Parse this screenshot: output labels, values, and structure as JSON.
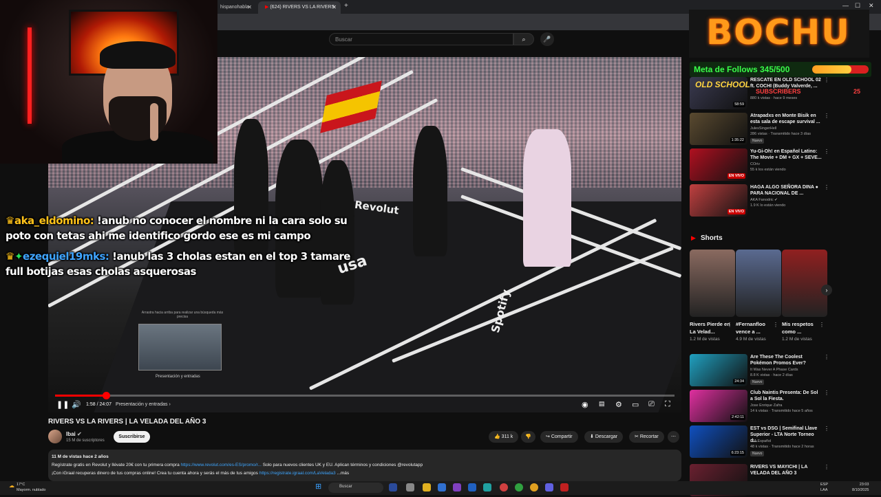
{
  "browser": {
    "tabs": [
      {
        "label": "hispanohabla",
        "active": false
      },
      {
        "label": "(624) RIVERS VS LA RIVERS",
        "active": true
      }
    ],
    "new_tab": "+"
  },
  "youtube": {
    "search_placeholder": "Buscar"
  },
  "stream_overlay": {
    "chat": [
      {
        "user": "aka_eldomino:",
        "message": "!anub no conocer el nombre ni la cara solo su",
        "message2": "poto con tetas ahi me identifico gordo ese es mi campo"
      },
      {
        "user": "ezequiel19mks:",
        "message": "!anub las 3 cholas estan en el top 3 tamare",
        "message2": "full botijas esas cholas asquerosas"
      }
    ],
    "brand": "BOCHU",
    "follow_goal": {
      "label": "Meta de Follows 345/500",
      "current": 345,
      "target": 500
    },
    "old_school": "OLD SCHOOL",
    "subscribers_label": "SUBSCRIBERS",
    "subscribers_count": "25"
  },
  "player": {
    "timecode": "1:58 / 24:07",
    "chapter": "Presentación y entradas",
    "progress": 0.082,
    "preview_hint": "Arrastra hacia arriba para realizar una búsqueda más precisa",
    "preview_label": "Presentación y entradas",
    "canvas_brand1": "Revolut",
    "canvas_brand2": "usa",
    "canvas_brand3": "Spotify"
  },
  "video": {
    "title": "RIVERS VS LA RIVERS | LA VELADA DEL AÑO 3",
    "channel": "Ibai",
    "subscribers": "15 M de suscriptores",
    "subscribe_label": "Suscribirse",
    "likes": "311 k",
    "share_label": "Compartir",
    "download_label": "Descargar",
    "clip_label": "Recortar",
    "description": {
      "line1": "11 M de vistas  hace 2 años",
      "line2a": "Regístrate gratis en Revolut y llévate 20€ con tu primera compra",
      "line2_link": "https://www.revolut.com/es-ES/promo/r...",
      "line2b": "Solo para nuevos clientes UK y EU. Aplican términos y condiciones @revolutapp",
      "line3a": "¡Con iGraal recuperas dinero de tus compras online! Crea tu cuenta ahora y serás el más",
      "line3b": "de tus amigos",
      "line3_link": "https://registrate.igraal.com/LaVelada3",
      "line3_more": "...más"
    }
  },
  "recommendations": [
    {
      "title": "RESCATE EN OLD SCHOOL 02 ft. COCHI (Buddy Valverde, ...",
      "channel": "",
      "meta": "880 k vistas · hace 9 meses",
      "duration": "58:59",
      "live": false,
      "new": false,
      "color": "#3a3a50"
    },
    {
      "title": "Atrapadxs en Monte Bisik en esta sala de escape survival ...",
      "channel": "JulesSingerHell",
      "meta": "286 vistas · Transmitido hace 3 días",
      "duration": "1:35:22",
      "live": false,
      "new": true,
      "color": "#5a4a30"
    },
    {
      "title": "Yu-Gi-Oh! en Español Latino: The Movie + DM + GX + SEVE...",
      "channel": "COriv",
      "meta": "55 k los están viendo",
      "duration": "EN VIVO",
      "live": true,
      "new": false,
      "color": "#b01020"
    },
    {
      "title": "HAGA ALGO SEÑORA DINA ● PARA NACIONAL DE ...",
      "channel": "AKA Fanodric ✔",
      "meta": "1.9 K lo están viendo",
      "duration": "EN VIVO",
      "live": true,
      "new": false,
      "color": "#c04040"
    },
    {
      "title": "Are These The Coolest Pokémon Promos Ever?",
      "channel": "It Was Never A Phase Cards",
      "meta": "8.8 K vistas · hace 2 días",
      "duration": "24:34",
      "live": false,
      "new": true,
      "color": "#20a0c0"
    },
    {
      "title": "Club Naintis Presenta: De Sol a Sol la Fiesta.",
      "channel": "Jose Enrique Zafra",
      "meta": "14 k vistas · Transmitido hace 5 años",
      "duration": "2:42:11",
      "live": false,
      "new": false,
      "color": "#e030a0"
    },
    {
      "title": "EST vs DSG | Semifinal Llave Superior - LTA Norte Torneo d...",
      "channel": "LTA Español",
      "meta": "48 k vistas · Transmitido hace 2 horas",
      "duration": "6:23:15",
      "live": false,
      "new": true,
      "color": "#1050c0"
    },
    {
      "title": "RIVERS VS MAYICHI | LA VELADA DEL AÑO 3",
      "channel": "",
      "meta": "",
      "duration": "",
      "live": false,
      "new": false,
      "color": "#6a2030"
    }
  ],
  "shorts": {
    "title": "Shorts",
    "items": [
      {
        "title": "Rivers Pierde en La Velad...",
        "views": "1.2 M de vistas",
        "color": "#8a6a60"
      },
      {
        "title": "#Fernanfloo vence a ...",
        "views": "4.9 M de vistas",
        "color": "#5a6a90"
      },
      {
        "title": "Mis respetos como ...",
        "views": "1.2 M de vistas",
        "color": "#902020"
      }
    ]
  },
  "taskbar": {
    "temp": "17°C",
    "weather": "Mayorm. nublado",
    "search": "Buscar",
    "lang1": "ESP",
    "lang2": "LAA",
    "time": "23:03",
    "date": "8/10/2025"
  }
}
